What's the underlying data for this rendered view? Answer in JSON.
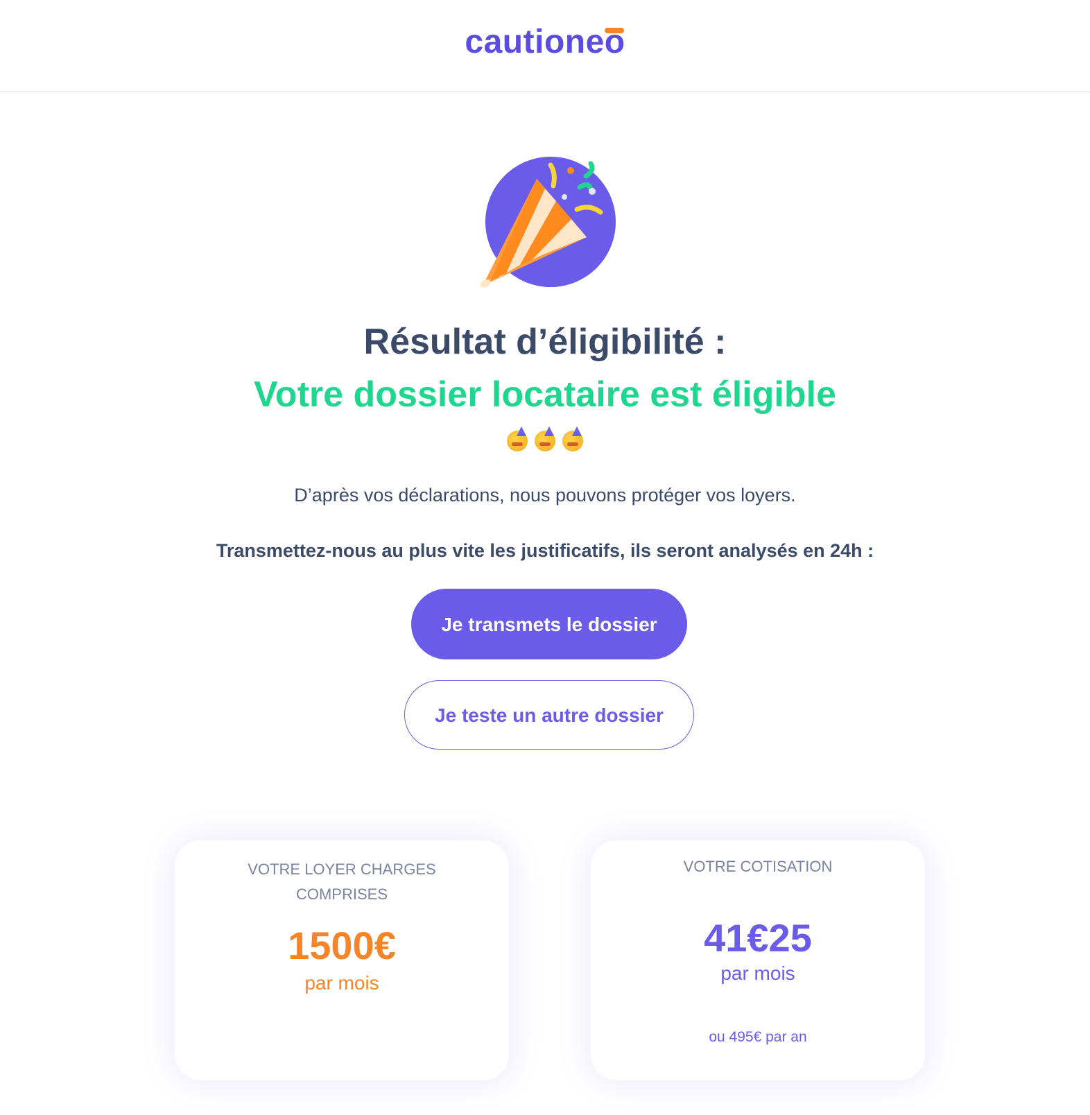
{
  "header": {
    "logo_text": "cautioneo"
  },
  "hero": {
    "icon": "party-popper-icon",
    "title": "Résultat d’éligibilité :",
    "status": "Votre dossier locataire est éligible",
    "emoji_icon": "partying-face-icon",
    "emoji_count": 3
  },
  "message": {
    "intro": "D’après vos déclarations, nous pouvons protéger vos loyers.",
    "call_to_action": "Transmettez-nous au plus vite les justificatifs, ils seront analysés en 24h :"
  },
  "actions": {
    "primary_label": "Je transmets le dossier",
    "secondary_label": "Je teste un autre dossier"
  },
  "cards": {
    "rent": {
      "label_line1": "VOTRE LOYER CHARGES",
      "label_line2": "COMPRISES",
      "value": "1500€",
      "period": "par mois"
    },
    "contribution": {
      "label": "VOTRE COTISATION",
      "value": "41€25",
      "period": "par mois",
      "yearly": "ou 495€ par an"
    }
  },
  "colors": {
    "brand_purple": "#6a5be8",
    "success_green": "#1fd68e",
    "accent_orange": "#f6852a",
    "text_dark": "#3b4a68",
    "text_muted": "#7a839e"
  }
}
